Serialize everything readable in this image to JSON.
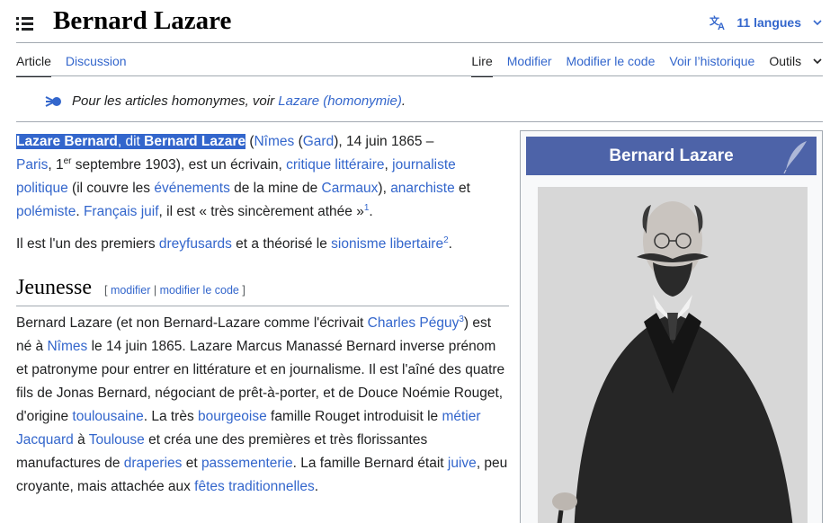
{
  "header": {
    "title": "Bernard Lazare",
    "languages_label": "11 langues"
  },
  "tabs": {
    "left": [
      "Article",
      "Discussion"
    ],
    "right": [
      "Lire",
      "Modifier",
      "Modifier le code",
      "Voir l’historique",
      "Outils"
    ]
  },
  "hatnote": {
    "prefix": "Pour les articles homonymes, voir ",
    "link": "Lazare (homonymie)",
    "suffix": "."
  },
  "intro": {
    "s1_name": "Lazare Bernard",
    "s1_dit": ", dit ",
    "s1_alias": "Bernard Lazare",
    "s1_open": " (",
    "nimes": "Nîmes",
    "gard_open": " (",
    "gard": "Gard",
    "date_birth": "), 14 juin 1865 –",
    "paris": "Paris",
    "death_a": ", 1",
    "death_sup": "er",
    "death_b": " septembre 1903), est un écrivain, ",
    "critique": "critique littéraire",
    "comma1": ", ",
    "journaliste": "journaliste politique",
    "couvre": " (il couvre les ",
    "evenements": "événements",
    "mine": " de la mine de ",
    "carmaux": "Carmaux",
    "close1": "), ",
    "anarchiste": "anarchiste",
    "et": " et ",
    "polemiste": "polémiste",
    "dot": ". ",
    "francais_juif": "Français juif",
    "athee": ", il est « très sincèrement athée »",
    "ref1": "1",
    "end": "."
  },
  "para2": {
    "a": "Il est l'un des premiers ",
    "dreyfusards": "dreyfusards",
    "b": " et a théorisé le ",
    "sionisme": "sionisme libertaire",
    "ref2": "2",
    "end": "."
  },
  "section": {
    "heading": "Jeunesse",
    "bracket_open": "[ ",
    "edit": "modifier",
    "sep": " | ",
    "edit_code": "modifier le code",
    "bracket_close": " ]"
  },
  "para3": {
    "a": "Bernard Lazare (et non Bernard-Lazare comme l'écrivait ",
    "peguy": "Charles Péguy",
    "ref3": "3",
    "b": ") est né à ",
    "nimes": "Nîmes",
    "c": " le 14 juin 1865. Lazare Marcus Manassé Bernard inverse prénom et patronyme pour entrer en littérature et en journalisme. Il est l'aîné des quatre fils de Jonas Bernard, négociant de prêt-à-porter, et de Douce Noémie Rouget, d'origine ",
    "toulousaine": "toulousaine",
    "d": ". La très ",
    "bourgeoise": "bourgeoise",
    "e": " famille Rouget introduisit le ",
    "metier": "métier Jacquard",
    "f": " à ",
    "toulouse": "Toulouse",
    "g": " et créa une des premières et très florissantes manufactures de ",
    "draperies": "draperies",
    "h": " et ",
    "passementerie": "passementerie",
    "i": ". La famille Bernard était ",
    "juive": "juive",
    "j": ", peu croyante, mais attachée aux ",
    "fetes": "fêtes traditionnelles",
    "k": "."
  },
  "infobox": {
    "title": "Bernard Lazare"
  },
  "colors": {
    "link": "#3366cc",
    "infobox_header": "#4d63a8",
    "selection": "#3366cc"
  },
  "icons": [
    "menu-icon",
    "translate-icon",
    "chevron-down-icon",
    "disambiguation-icon",
    "quill-icon"
  ]
}
